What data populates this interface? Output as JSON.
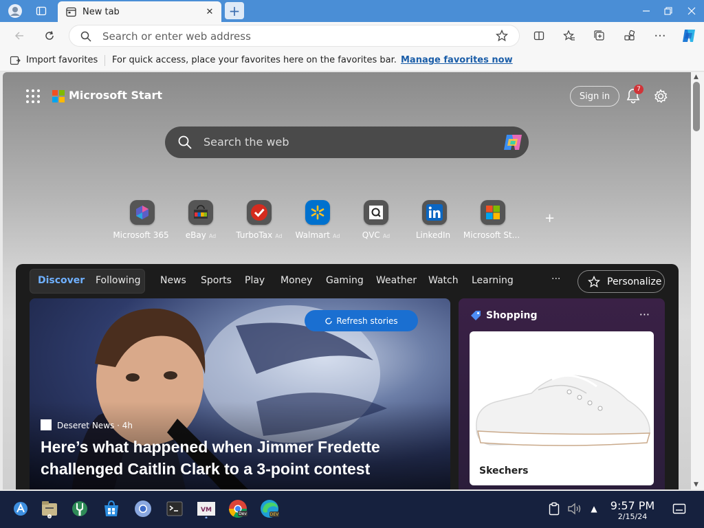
{
  "browser": {
    "tab_title": "New tab",
    "address_placeholder": "Search or enter web address"
  },
  "favorites_bar": {
    "import_label": "Import favorites",
    "message": "For quick access, place your favorites here on the favorites bar.",
    "manage_link": "Manage favorites now"
  },
  "start": {
    "brand": "Microsoft Start",
    "sign_in": "Sign in",
    "notification_count": "7",
    "search_placeholder": "Search the web"
  },
  "quick_links": [
    {
      "label": "Microsoft 365",
      "ad": ""
    },
    {
      "label": "eBay",
      "ad": "Ad"
    },
    {
      "label": "TurboTax",
      "ad": "Ad"
    },
    {
      "label": "Walmart",
      "ad": "Ad"
    },
    {
      "label": "QVC",
      "ad": "Ad"
    },
    {
      "label": "LinkedIn",
      "ad": ""
    },
    {
      "label": "Microsoft St...",
      "ad": ""
    }
  ],
  "feed": {
    "nav": [
      "Discover",
      "Following",
      "News",
      "Sports",
      "Play",
      "Money",
      "Gaming",
      "Weather",
      "Watch",
      "Learning"
    ],
    "more": "···",
    "personalize": "Personalize",
    "refresh": "Refresh stories",
    "hero": {
      "source": "Deseret News · 4h",
      "title": "Here’s what happened when Jimmer Fredette challenged Caitlin Clark to a 3-point contest"
    },
    "shopping": {
      "header": "Shopping",
      "more": "···",
      "product_name": "Skechers"
    }
  },
  "taskbar": {
    "time": "9:57 PM",
    "date": "2/15/24"
  },
  "colors": {
    "accent": "#1a6fd1",
    "tabstrip": "#4a8ed6",
    "taskbar": "#16213e",
    "badge": "#d13438"
  }
}
